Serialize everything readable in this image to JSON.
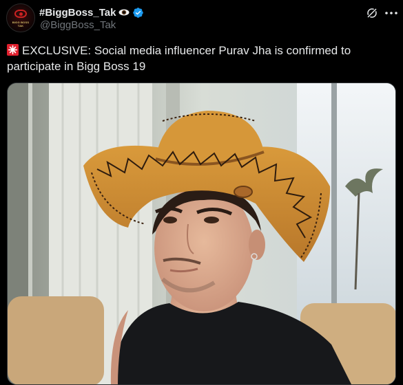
{
  "account": {
    "display_name": "#BiggBoss_Tak",
    "handle": "@BiggBoss_Tak",
    "verified": true,
    "avatar_logo_text": "BIGG BOSS TAK"
  },
  "tweet": {
    "emoji_icon": "police-siren-icon",
    "text": "EXCLUSIVE: Social media influencer Purav Jha is confirmed to participate in Bigg Boss 19"
  },
  "icons": {
    "grok": "grok-icon",
    "more": "more-options-icon",
    "verified": "verified-badge-icon",
    "eye": "eye-emoji-icon"
  },
  "colors": {
    "background": "#000000",
    "text": "#e7e9ea",
    "secondary_text": "#71767b",
    "verified_blue": "#1d9bf0"
  }
}
